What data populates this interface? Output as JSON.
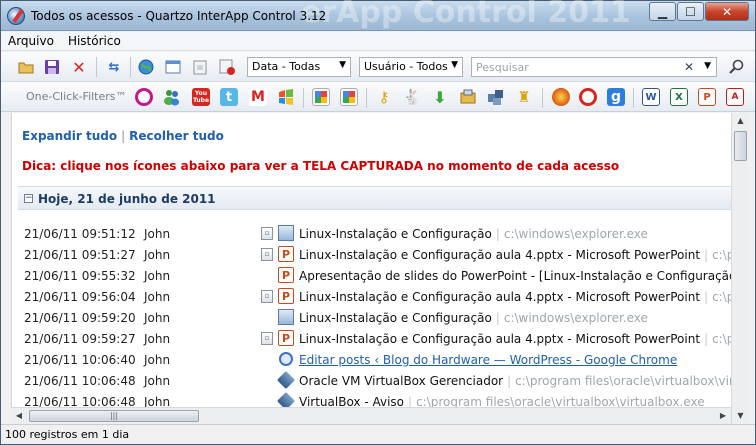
{
  "window": {
    "title": "Todos os acessos - Quartzo InterApp Control 3.12",
    "background_banner": "erApp Control 2011",
    "buttons": {
      "minimize": "▁",
      "maximize": "☐",
      "close": "✕"
    }
  },
  "menu": [
    "Arquivo",
    "Histórico"
  ],
  "toolbar": {
    "date_filter": "Data - Todas",
    "user_filter": "Usuário - Todos",
    "search_placeholder": "Pesquisar"
  },
  "filters_bar": {
    "label": "One-Click-Filters™",
    "icons": [
      "opera-icon",
      "messenger-icon",
      "youtube-icon",
      "twitter-icon",
      "gmail-icon",
      "msn-icon",
      "google-icon",
      "google-icon-2",
      "key-icon",
      "playboy-icon",
      "download-icon",
      "archive-icon",
      "network-icon",
      "trophy-icon",
      "firefox-icon",
      "opera-icon-2",
      "google-g-icon",
      "word-icon",
      "excel-icon",
      "powerpoint-icon",
      "pdf-icon"
    ],
    "youtube_text": "You\nTube"
  },
  "content": {
    "expand_all": "Expandir tudo",
    "collapse_all": "Recolher tudo",
    "tip": "Dica: clique nos ícones abaixo para ver a TELA CAPTURADA no momento de cada acesso",
    "day_header": "Hoje, 21 de junho de 2011",
    "rows": [
      {
        "datetime": "21/06/11  09:51:12",
        "user": "John",
        "app": "explorer",
        "capture": true,
        "window": "Linux-Instalação e Configuração",
        "process": "c:\\windows\\explorer.exe",
        "link": false
      },
      {
        "datetime": "21/06/11  09:51:27",
        "user": "John",
        "app": "powerpoint",
        "capture": true,
        "window": "Linux-Instalação e Configuração aula 4.pptx - Microsoft PowerPoint",
        "process": "c:\\pro",
        "link": false
      },
      {
        "datetime": "21/06/11  09:55:32",
        "user": "John",
        "app": "powerpoint",
        "capture": false,
        "window": "Apresentação de slides do PowerPoint - [Linux-Instalação e Configuração au",
        "process": "",
        "link": false
      },
      {
        "datetime": "21/06/11  09:56:04",
        "user": "John",
        "app": "powerpoint",
        "capture": true,
        "window": "Linux-Instalação e Configuração aula 4.pptx - Microsoft PowerPoint",
        "process": "c:\\pro",
        "link": false
      },
      {
        "datetime": "21/06/11  09:59:20",
        "user": "John",
        "app": "explorer",
        "capture": false,
        "window": "Linux-Instalação e Configuração",
        "process": "c:\\windows\\explorer.exe",
        "link": false
      },
      {
        "datetime": "21/06/11  09:59:27",
        "user": "John",
        "app": "powerpoint",
        "capture": true,
        "window": "Linux-Instalação e Configuração aula 4.pptx - Microsoft PowerPoint",
        "process": "c:\\pro",
        "link": false
      },
      {
        "datetime": "21/06/11  10:06:40",
        "user": "John",
        "app": "chrome",
        "capture": false,
        "window": "Editar posts ‹ Blog do Hardware — WordPress - Google Chrome",
        "process": "",
        "link": true
      },
      {
        "datetime": "21/06/11  10:06:48",
        "user": "John",
        "app": "virtualbox",
        "capture": false,
        "window": "Oracle VM VirtualBox Gerenciador",
        "process": "c:\\program files\\oracle\\virtualbox\\virtu",
        "link": false
      },
      {
        "datetime": "21/06/11  10:06:48",
        "user": "John",
        "app": "virtualbox",
        "capture": false,
        "window": "VirtualBox - Aviso",
        "process": "c:\\program files\\oracle\\virtualbox\\virtualbox.exe",
        "link": false
      }
    ]
  },
  "status": {
    "text": "100 registros em 1 dia"
  },
  "scrollbar": {
    "thumb_grip": "|||"
  }
}
